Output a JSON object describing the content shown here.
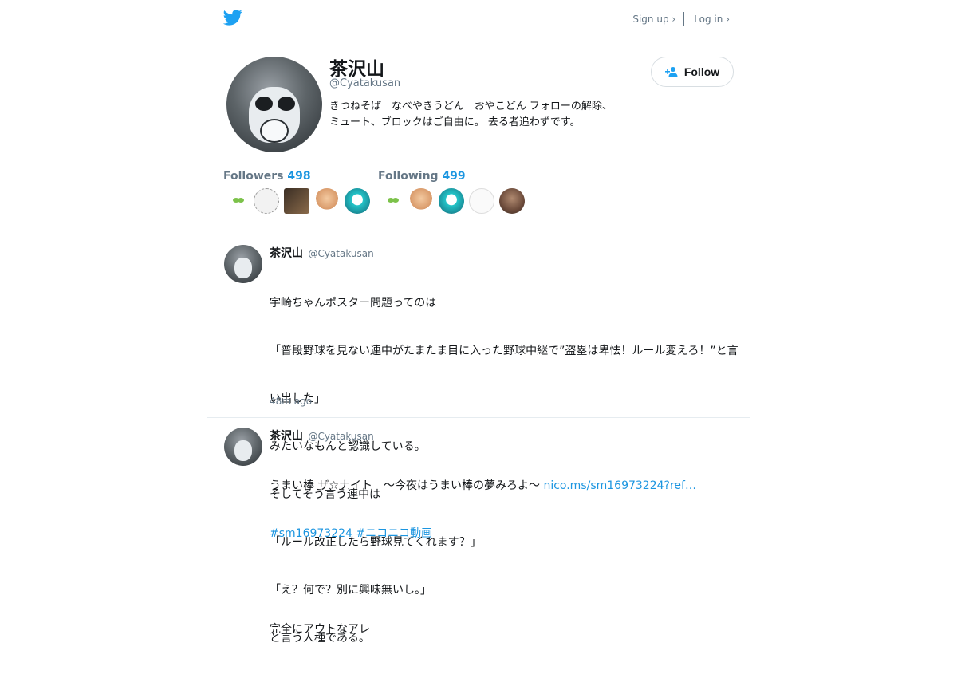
{
  "header": {
    "logo": "twitter-bird-icon",
    "signup_label": "Sign up ›",
    "login_label": "Log in ›",
    "brand_color": "#1DA1F2"
  },
  "profile": {
    "name": "茶沢山",
    "handle": "@Cyatakusan",
    "bio_line1": "きつねそば　なべやきうどん　おやこどん フォローの解除、",
    "bio_line2": "ミュート、ブロックはご自由に。 去る者追わずです。",
    "follow_label": "Follow",
    "followers_label": "Followers",
    "followers_count": "498",
    "following_label": "Following",
    "following_count": "499",
    "followers_thumbs": [
      "sprout",
      "sketch",
      "dark-photo",
      "muscle-man",
      "miku"
    ],
    "following_thumbs": [
      "sprout",
      "muscle-man",
      "miku",
      "text-image",
      "photo"
    ]
  },
  "tweets": [
    {
      "name": "茶沢山",
      "handle": "@Cyatakusan",
      "lines": [
        "宇崎ちゃんポスター問題ってのは",
        "「普段野球を見ない連中がたまたま目に入った野球中継で”盗塁は卑怯！ルール変えろ！”と言",
        "い出した」",
        "みたいなもんと認識している。",
        "そしてそう言う連中は",
        "「ルール改正したら野球見てくれます？」",
        "「え？何で？別に興味無いし。」",
        "と言う人種である。"
      ],
      "time": "48m ago"
    },
    {
      "name": "茶沢山",
      "handle": "@Cyatakusan",
      "text_prefix": "うまい棒 ザ☆ナイト　～今夜はうまい棒の夢みろよ～ ",
      "link": "nico.ms/sm16973224?ref…",
      "hashtag1": "#sm16973224",
      "hashtag2": "#ニコニコ動画",
      "text_after": "完全にアウトなアレ"
    }
  ]
}
